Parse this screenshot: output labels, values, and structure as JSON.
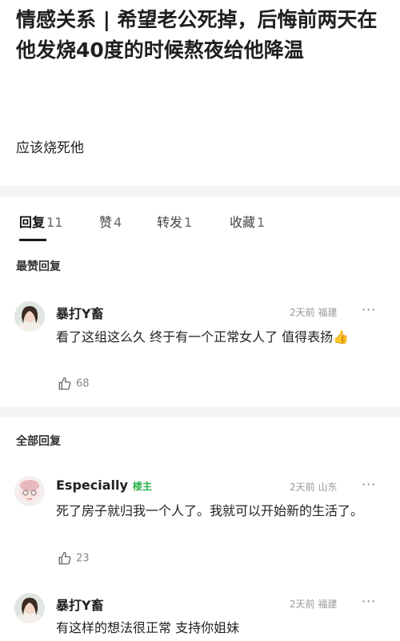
{
  "post": {
    "title": "情感关系 | 希望老公死掉，后悔前两天在他发烧40度的时候熬夜给他降温",
    "body": "应该烧死他"
  },
  "tabs": [
    {
      "label": "回复",
      "count": "11"
    },
    {
      "label": "赞",
      "count": "4"
    },
    {
      "label": "转发",
      "count": "1"
    },
    {
      "label": "收藏",
      "count": "1"
    }
  ],
  "top_section": "最赞回复",
  "all_section": "全部回复",
  "top_comment": {
    "author": "暴打Y畜",
    "time": "2天前",
    "location": "福建",
    "text": "看了这组这么久 终于有一个正常女人了 值得表扬",
    "emoji": "👍",
    "likes": "68"
  },
  "comments": [
    {
      "author": "Especially",
      "badge": "楼主",
      "time": "2天前",
      "location": "山东",
      "text": "死了房子就归我一个人了。我就可以开始新的生活了。",
      "likes": "23"
    },
    {
      "author": "暴打Y畜",
      "time": "2天前",
      "location": "福建",
      "text": "有这样的想法很正常 支持你姐妹"
    }
  ],
  "more_icon": "···",
  "colors": {
    "op_badge": "#2bb24c",
    "separator": "#f4f4f4"
  }
}
